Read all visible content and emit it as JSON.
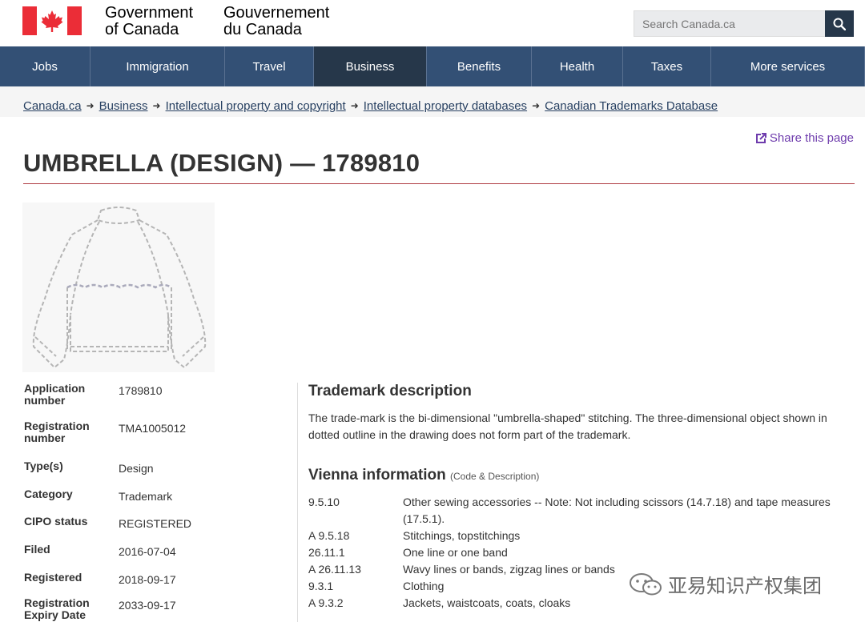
{
  "header": {
    "gov_en_line1": "Government",
    "gov_en_line2": "of Canada",
    "gov_fr_line1": "Gouvernement",
    "gov_fr_line2": "du Canada",
    "search_placeholder": "Search Canada.ca"
  },
  "nav": [
    {
      "label": "Jobs",
      "width": 113
    },
    {
      "label": "Immigration",
      "width": 168
    },
    {
      "label": "Travel",
      "width": 111
    },
    {
      "label": "Business",
      "width": 141,
      "active": true
    },
    {
      "label": "Benefits",
      "width": 131
    },
    {
      "label": "Health",
      "width": 114
    },
    {
      "label": "Taxes",
      "width": 110
    },
    {
      "label": "More services",
      "width": 192
    }
  ],
  "breadcrumb": [
    "Canada.ca",
    "Business",
    "Intellectual property and copyright",
    "Intellectual property databases",
    "Canadian Trademarks Database"
  ],
  "share_label": "Share this page",
  "title": "UMBRELLA (DESIGN) — 1789810",
  "details": [
    {
      "label": "Application number",
      "value": "1789810"
    },
    {
      "label": "Registration number",
      "value": "TMA1005012"
    },
    {
      "label": "Type(s)",
      "value": "Design"
    },
    {
      "label": "Category",
      "value": "Trademark"
    },
    {
      "label": "CIPO status",
      "value": "REGISTERED"
    },
    {
      "label": "Filed",
      "value": "2016-07-04"
    },
    {
      "label": "Registered",
      "value": "2018-09-17"
    },
    {
      "label": "Registration Expiry Date",
      "value": "2033-09-17"
    }
  ],
  "description": {
    "heading": "Trademark description",
    "text": "The trade-mark is the bi-dimensional \"umbrella-shaped\" stitching. The three-dimensional object shown in dotted outline in the drawing does not form part of the trademark."
  },
  "vienna": {
    "heading": "Vienna information",
    "note": "(Code & Description)",
    "rows": [
      {
        "code": "9.5.10",
        "desc": "Other sewing accessories -- Note: Not including scissors (14.7.18) and tape measures (17.5.1)."
      },
      {
        "code": "A 9.5.18",
        "desc": "Stitchings, topstitchings"
      },
      {
        "code": "26.11.1",
        "desc": "One line or one band"
      },
      {
        "code": "A 26.11.13",
        "desc": "Wavy lines or bands, zigzag lines or bands"
      },
      {
        "code": "9.3.1",
        "desc": "Clothing"
      },
      {
        "code": "A 9.3.2",
        "desc": "Jackets, waistcoats, coats, cloaks"
      }
    ]
  },
  "watermark": "亚易知识产权集团",
  "colors": {
    "nav_bg": "#335075",
    "nav_active": "#26374a",
    "title_rule": "#af3c43",
    "link": "#284162",
    "share": "#6f3dad",
    "flag_red": "#eb2d37"
  }
}
